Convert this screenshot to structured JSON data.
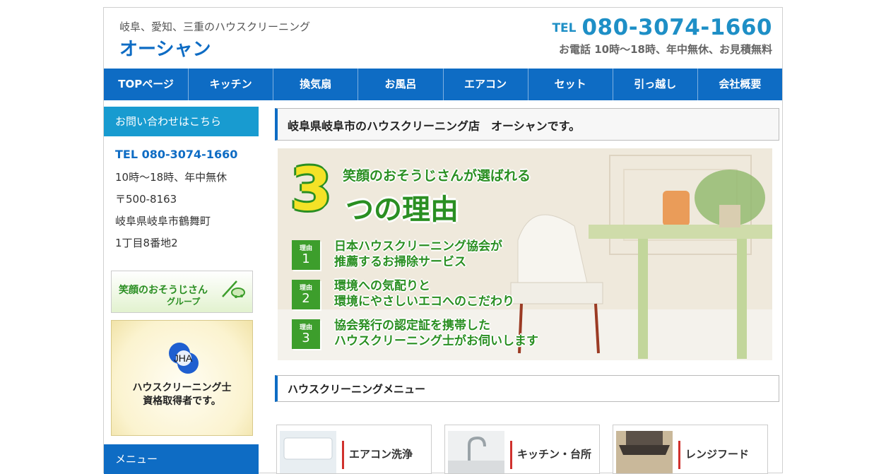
{
  "header": {
    "tagline": "岐阜、愛知、三重のハウスクリーニング",
    "brand": "オーシャン",
    "tel_prefix": "TEL",
    "tel_number": "080-3074-1660",
    "hours": "お電話 10時～18時、年中無休、お見積無料"
  },
  "nav": {
    "items": [
      "TOPページ",
      "キッチン",
      "換気扇",
      "お風呂",
      "エアコン",
      "セット",
      "引っ越し",
      "会社概要"
    ]
  },
  "sidebar": {
    "contact_heading": "お問い合わせはこちら",
    "tel": "TEL 080-3074-1660",
    "hours": "10時～18時、年中無休",
    "postal": "〒500-8163",
    "address1": "岐阜県岐阜市鶴舞町",
    "address2": "1丁目8番地2",
    "banner_group": {
      "line1": "笑顔のおそうじさん",
      "line2": "グループ"
    },
    "banner_jha": {
      "logo": "JHA",
      "line1": "ハウスクリーニング士",
      "line2": "資格取得者です。"
    },
    "menu_heading": "メニュー"
  },
  "main": {
    "page_title": "岐阜県岐阜市のハウスクリーニング店　オーシャンです。",
    "hero": {
      "subtitle": "笑顔のおそうじさんが選ばれる",
      "big_number": "3",
      "headline": "つの理由",
      "reasons": [
        {
          "badge": "理由",
          "num": "1",
          "line1": "日本ハウスクリーニング協会が",
          "line2": "推薦するお掃除サービス"
        },
        {
          "badge": "理由",
          "num": "2",
          "line1": "環境への気配りと",
          "line2": "環境にやさしいエコへのこだわり"
        },
        {
          "badge": "理由",
          "num": "3",
          "line1": "協会発行の認定証を携帯した",
          "line2": "ハウスクリーニング士がお伺いします"
        }
      ]
    },
    "menu_heading": "ハウスクリーニングメニュー",
    "cards": [
      {
        "label": "エアコン洗浄"
      },
      {
        "label": "キッチン・台所"
      },
      {
        "label": "レンジフード"
      }
    ]
  },
  "colors": {
    "primary": "#0e6cc4",
    "accent_blue": "#189bd0",
    "green": "#2a8f22",
    "yellow": "#f4e227"
  }
}
